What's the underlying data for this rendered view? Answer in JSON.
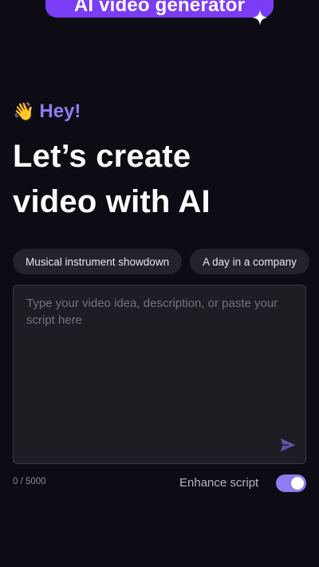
{
  "header": {
    "badge_text": "AI video generator",
    "sparkle_icon": "sparkle-icon"
  },
  "greeting": {
    "emoji": "👋",
    "text": "Hey!"
  },
  "headline": {
    "line1": "Let’s create",
    "line2": "video with AI"
  },
  "suggestions": [
    {
      "label": "Musical instrument showdown"
    },
    {
      "label": "A day in a company"
    }
  ],
  "prompt": {
    "placeholder": "Type your video idea, description, or paste your script here",
    "value": "",
    "send_icon": "send-icon"
  },
  "footer": {
    "char_count": "0 / 5000",
    "enhance_label": "Enhance script",
    "enhance_enabled": true
  },
  "colors": {
    "background": "#0d0c15",
    "brand_purple": "#7b3cf6",
    "accent_lavender": "#8e7cf0",
    "chip_bg": "#24232c",
    "input_bg": "#1e1d24"
  }
}
